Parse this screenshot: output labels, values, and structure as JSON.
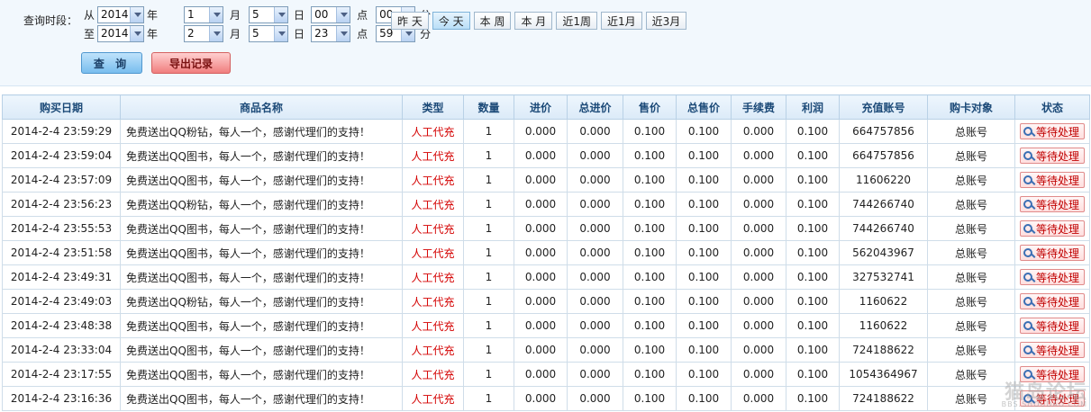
{
  "filter": {
    "label": "查询时段：",
    "from_label": "从",
    "to_label": "至",
    "unit_year": "年",
    "unit_month": "月",
    "unit_day": "日",
    "unit_hour": "点",
    "unit_minute": "分",
    "from": {
      "year": "2014",
      "month": "1",
      "day": "5",
      "hour": "00",
      "minute": "00"
    },
    "to": {
      "year": "2014",
      "month": "2",
      "day": "5",
      "hour": "23",
      "minute": "59"
    },
    "quick_buttons": [
      "昨 天",
      "今 天",
      "本 周",
      "本 月",
      "近1周",
      "近1月",
      "近3月"
    ],
    "active_quick": "今 天",
    "query_label": "查 询",
    "export_label": "导出记录"
  },
  "table": {
    "columns": [
      "购买日期",
      "商品名称",
      "类型",
      "数量",
      "进价",
      "总进价",
      "售价",
      "总售价",
      "手续费",
      "利润",
      "充值账号",
      "购卡对象",
      "状态"
    ],
    "rows": [
      [
        "2014-2-4 23:59:29",
        "免费送出QQ粉钻，每人一个，感谢代理们的支持！",
        "人工代充",
        "1",
        "0.000",
        "0.000",
        "0.100",
        "0.100",
        "0.000",
        "0.100",
        "664757856",
        "总账号",
        "等待处理"
      ],
      [
        "2014-2-4 23:59:04",
        "免费送出QQ图书，每人一个，感谢代理们的支持！",
        "人工代充",
        "1",
        "0.000",
        "0.000",
        "0.100",
        "0.100",
        "0.000",
        "0.100",
        "664757856",
        "总账号",
        "等待处理"
      ],
      [
        "2014-2-4 23:57:09",
        "免费送出QQ图书，每人一个，感谢代理们的支持！",
        "人工代充",
        "1",
        "0.000",
        "0.000",
        "0.100",
        "0.100",
        "0.000",
        "0.100",
        "11606220",
        "总账号",
        "等待处理"
      ],
      [
        "2014-2-4 23:56:23",
        "免费送出QQ粉钻，每人一个，感谢代理们的支持！",
        "人工代充",
        "1",
        "0.000",
        "0.000",
        "0.100",
        "0.100",
        "0.000",
        "0.100",
        "744266740",
        "总账号",
        "等待处理"
      ],
      [
        "2014-2-4 23:55:53",
        "免费送出QQ图书，每人一个，感谢代理们的支持！",
        "人工代充",
        "1",
        "0.000",
        "0.000",
        "0.100",
        "0.100",
        "0.000",
        "0.100",
        "744266740",
        "总账号",
        "等待处理"
      ],
      [
        "2014-2-4 23:51:58",
        "免费送出QQ图书，每人一个，感谢代理们的支持！",
        "人工代充",
        "1",
        "0.000",
        "0.000",
        "0.100",
        "0.100",
        "0.000",
        "0.100",
        "562043967",
        "总账号",
        "等待处理"
      ],
      [
        "2014-2-4 23:49:31",
        "免费送出QQ图书，每人一个，感谢代理们的支持！",
        "人工代充",
        "1",
        "0.000",
        "0.000",
        "0.100",
        "0.100",
        "0.000",
        "0.100",
        "327532741",
        "总账号",
        "等待处理"
      ],
      [
        "2014-2-4 23:49:03",
        "免费送出QQ粉钻，每人一个，感谢代理们的支持！",
        "人工代充",
        "1",
        "0.000",
        "0.000",
        "0.100",
        "0.100",
        "0.000",
        "0.100",
        "1160622",
        "总账号",
        "等待处理"
      ],
      [
        "2014-2-4 23:48:38",
        "免费送出QQ图书，每人一个，感谢代理们的支持！",
        "人工代充",
        "1",
        "0.000",
        "0.000",
        "0.100",
        "0.100",
        "0.000",
        "0.100",
        "1160622",
        "总账号",
        "等待处理"
      ],
      [
        "2014-2-4 23:33:04",
        "免费送出QQ图书，每人一个，感谢代理们的支持！",
        "人工代充",
        "1",
        "0.000",
        "0.000",
        "0.100",
        "0.100",
        "0.000",
        "0.100",
        "724188622",
        "总账号",
        "等待处理"
      ],
      [
        "2014-2-4 23:17:55",
        "免费送出QQ图书，每人一个，感谢代理们的支持！",
        "人工代充",
        "1",
        "0.000",
        "0.000",
        "0.100",
        "0.100",
        "0.000",
        "0.100",
        "1054364967",
        "总账号",
        "等待处理"
      ],
      [
        "2014-2-4 23:16:36",
        "免费送出QQ图书，每人一个，感谢代理们的支持！",
        "人工代充",
        "1",
        "0.000",
        "0.000",
        "0.100",
        "0.100",
        "0.000",
        "0.100",
        "724188622",
        "总账号",
        "等待处理"
      ]
    ]
  },
  "watermark": {
    "main": "猫岛论坛",
    "sub": "BBS.SHOUDAO.COM"
  },
  "colors": {
    "accent": "#78bdee",
    "type_red": "#d40000",
    "header_text": "#1c4a78"
  }
}
